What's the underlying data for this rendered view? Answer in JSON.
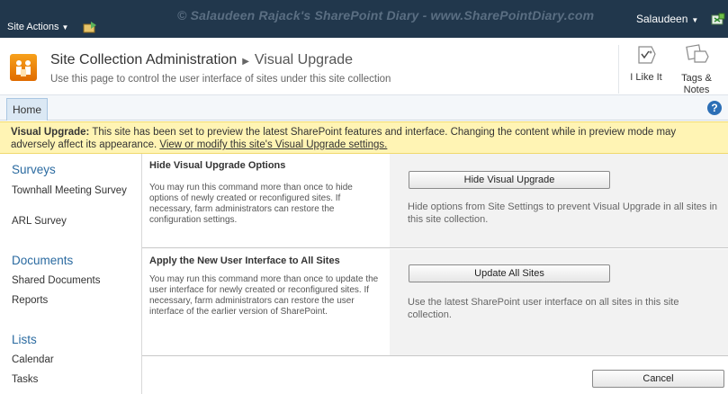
{
  "topbar": {
    "site_actions": "Site Actions",
    "watermark": "© Salaudeen Rajack's SharePoint Diary - www.SharePointDiary.com",
    "user": "Salaudeen"
  },
  "title_area": {
    "breadcrumb_root": "Site Collection Administration",
    "page_title": "Visual Upgrade",
    "description": "Use this page to control the user interface of sites under this site collection",
    "like_label": "I Like It",
    "tags_label_1": "Tags &",
    "tags_label_2": "Notes"
  },
  "tabs": {
    "home": "Home"
  },
  "status": {
    "label": "Visual Upgrade:",
    "text": "This site has been set to preview the latest SharePoint features and interface. Changing the content while in preview mode may adversely affect its appearance.",
    "link": "View or modify this site's Visual Upgrade settings."
  },
  "leftnav": {
    "surveys": {
      "heading": "Surveys",
      "items": [
        "Townhall Meeting Survey",
        "ARL Survey"
      ]
    },
    "documents": {
      "heading": "Documents",
      "items": [
        "Shared Documents",
        "Reports"
      ]
    },
    "lists": {
      "heading": "Lists",
      "items": [
        "Calendar",
        "Tasks"
      ]
    }
  },
  "sections": [
    {
      "title": "Hide Visual Upgrade Options",
      "description": "You may run this command more than once to hide options of newly created or reconfigured sites. If necessary, farm administrators can restore the configuration settings.",
      "button": "Hide Visual Upgrade",
      "button_description": "Hide options from Site Settings to prevent Visual Upgrade in all sites in this site collection."
    },
    {
      "title": "Apply the New User Interface to All Sites",
      "description": "You may run this command more than once to update the user interface for newly created or reconfigured sites. If necessary, farm administrators can restore the user interface of the earlier version of SharePoint.",
      "button": "Update All Sites",
      "button_description": "Use the latest SharePoint user interface on all sites in this site collection."
    }
  ],
  "footer": {
    "cancel": "Cancel"
  },
  "colors": {
    "topbar": "#21374c",
    "status_bg": "#fff4b4",
    "link": "#2a6aa0"
  }
}
